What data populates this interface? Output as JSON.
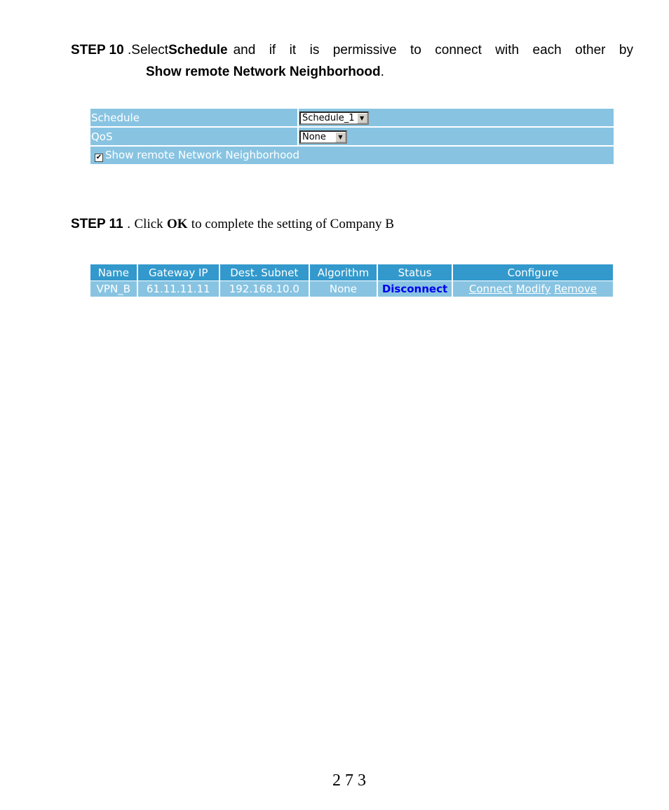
{
  "step10": {
    "label": "STEP 10",
    "separator": ".",
    "text_before": "Select",
    "bold1": "Schedule",
    "text_middle": "and if it is permissive to connect with each other by",
    "bold2": "Show remote Network Neighborhood",
    "text_end": "."
  },
  "form": {
    "schedule_label": "Schedule",
    "schedule_value": "Schedule_1",
    "qos_label": "QoS",
    "qos_value": "None",
    "show_remote_checked": true,
    "show_remote_label": "Show remote Network Neighborhood"
  },
  "step11": {
    "label": "STEP 11",
    "separator": ".",
    "text_before": "Click",
    "bold": "OK",
    "text_after": "to complete the setting of Company B"
  },
  "vpn_table": {
    "headers": [
      "Name",
      "Gateway IP",
      "Dest. Subnet",
      "Algorithm",
      "Status",
      "Configure"
    ],
    "rows": [
      {
        "name": "VPN_B",
        "gateway_ip": "61.11.11.11",
        "dest_subnet": "192.168.10.0",
        "algorithm": "None",
        "status": "Disconnect",
        "actions": [
          "Connect",
          "Modify",
          "Remove"
        ]
      }
    ]
  },
  "colors": {
    "header_bg": "#3399cc",
    "row_bg": "#88c4e2",
    "status_link": "#0000ee"
  },
  "page_number": "273"
}
